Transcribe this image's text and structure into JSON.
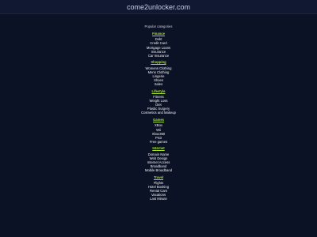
{
  "header": {
    "site_title": "come2unlocker.com"
  },
  "intro": "Popular categories",
  "categories": [
    {
      "title": "Finance",
      "items": [
        "Debt",
        "Credit Card",
        "Mortgage Loans",
        "Insurance",
        "Car Insurance"
      ]
    },
    {
      "title": "Shopping",
      "items": [
        "Womens Clothing",
        "Mens Clothing",
        "Lingerie",
        "Shoes",
        "Sales"
      ]
    },
    {
      "title": "Lifestyle",
      "items": [
        "Fitness",
        "Weight Loss",
        "Diet",
        "Plastic Surgery",
        "Cosmetics and Makeup"
      ]
    },
    {
      "title": "Games",
      "items": [
        "XBox",
        "Wii",
        "Xbox360",
        "PS3",
        "Free games"
      ]
    },
    {
      "title": "Internet",
      "items": [
        "Domain Name",
        "Web Design",
        "Internet Access",
        "Broadband",
        "Mobile Broadband"
      ]
    },
    {
      "title": "Travel",
      "items": [
        "Flights",
        "Hotel Booking",
        "Rental Cars",
        "Vacations",
        "Last Minute"
      ]
    }
  ],
  "colors": {
    "background": "#0c1226",
    "category_title": "#a6df2a",
    "link": "#f2f3f5"
  }
}
